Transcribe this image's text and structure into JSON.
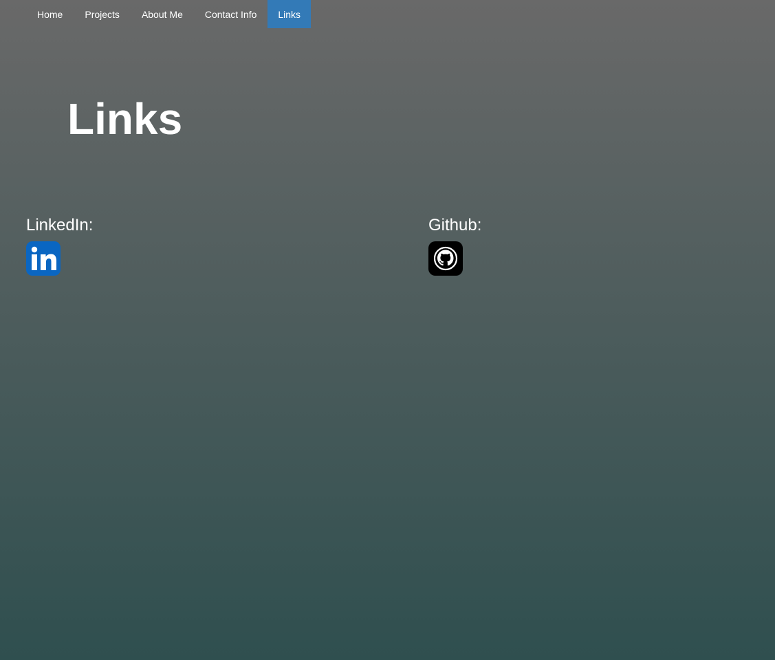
{
  "nav": {
    "items": [
      {
        "label": "Home",
        "active": false
      },
      {
        "label": "Projects",
        "active": false
      },
      {
        "label": "About Me",
        "active": false
      },
      {
        "label": "Contact Info",
        "active": false
      },
      {
        "label": "Links",
        "active": true
      }
    ]
  },
  "page": {
    "title": "Links"
  },
  "links": {
    "linkedin": {
      "label": "LinkedIn:",
      "icon": "linkedin-icon",
      "color": "#0a66c2"
    },
    "github": {
      "label": "Github:",
      "icon": "github-icon",
      "color": "#000000"
    }
  },
  "colors": {
    "nav_active": "#337ab7",
    "background_top": "#696969",
    "background_bottom": "#2f4f4f"
  }
}
